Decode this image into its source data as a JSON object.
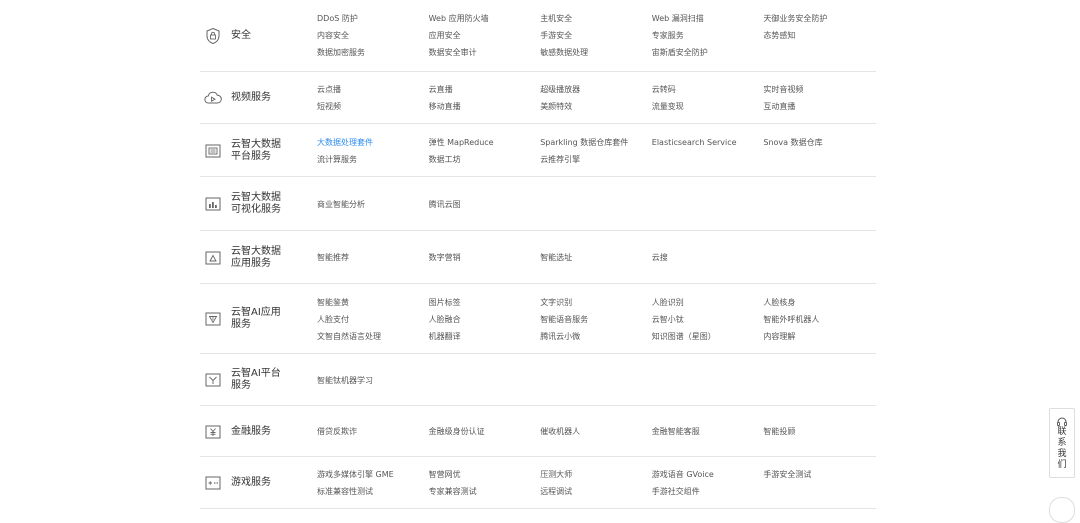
{
  "categories": [
    {
      "name": "安全",
      "icon": "security-icon",
      "items": [
        "DDoS 防护",
        "Web 应用防火墙",
        "主机安全",
        "Web 漏洞扫描",
        "天御业务安全防护",
        "内容安全",
        "应用安全",
        "手游安全",
        "专家服务",
        "态势感知",
        "数据加密服务",
        "数据安全审计",
        "敏感数据处理",
        "宙斯盾安全防护"
      ]
    },
    {
      "name": "视频服务",
      "icon": "video-cloud-icon",
      "items": [
        "云点播",
        "云直播",
        "超级播放器",
        "云转码",
        "实时音视频",
        "短视频",
        "移动直播",
        "美颜特效",
        "流量变现",
        "互动直播"
      ]
    },
    {
      "name": "云智大数据\n平台服务",
      "icon": "data-platform-icon",
      "items": [
        "大数据处理套件",
        "弹性 MapReduce",
        "Sparkling 数据仓库套件",
        "Elasticsearch Service",
        "Snova 数据仓库",
        "流计算服务",
        "数据工坊",
        "云推荐引擎"
      ],
      "active_item": "大数据处理套件"
    },
    {
      "name": "云智大数据\n可视化服务",
      "icon": "bar-chart-icon",
      "items": [
        "商业智能分析",
        "腾讯云图"
      ]
    },
    {
      "name": "云智大数据\n应用服务",
      "icon": "data-app-icon",
      "items": [
        "智能推荐",
        "数字营销",
        "智能选址",
        "云搜"
      ]
    },
    {
      "name": "云智AI应用\n服务",
      "icon": "ai-app-icon",
      "items": [
        "智能鉴黄",
        "图片标签",
        "文字识别",
        "人脸识别",
        "人脸核身",
        "人脸支付",
        "人脸融合",
        "智能语音服务",
        "云智小钛",
        "智能外呼机器人",
        "文智自然语言处理",
        "机器翻译",
        "腾讯云小微",
        "知识图谱（星图）",
        "内容理解"
      ]
    },
    {
      "name": "云智AI平台\n服务",
      "icon": "ai-platform-icon",
      "items": [
        "智能钛机器学习"
      ]
    },
    {
      "name": "金融服务",
      "icon": "yuan-icon",
      "items": [
        "借贷反欺诈",
        "金融级身份认证",
        "催收机器人",
        "金融智能客服",
        "智能投顾"
      ]
    },
    {
      "name": "游戏服务",
      "icon": "game-icon",
      "items": [
        "游戏多媒体引擎 GME",
        "智营网优",
        "压测大师",
        "游戏语音 GVoice",
        "手游安全测试",
        "标准兼容性测试",
        "专家兼容测试",
        "远程调试",
        "手游社交组件"
      ]
    }
  ],
  "contact": {
    "label": "联系我们",
    "icon": "headset-icon"
  },
  "colors": {
    "text": "#555555",
    "active": "#2d8cf0",
    "divider": "#e5e5e5"
  }
}
